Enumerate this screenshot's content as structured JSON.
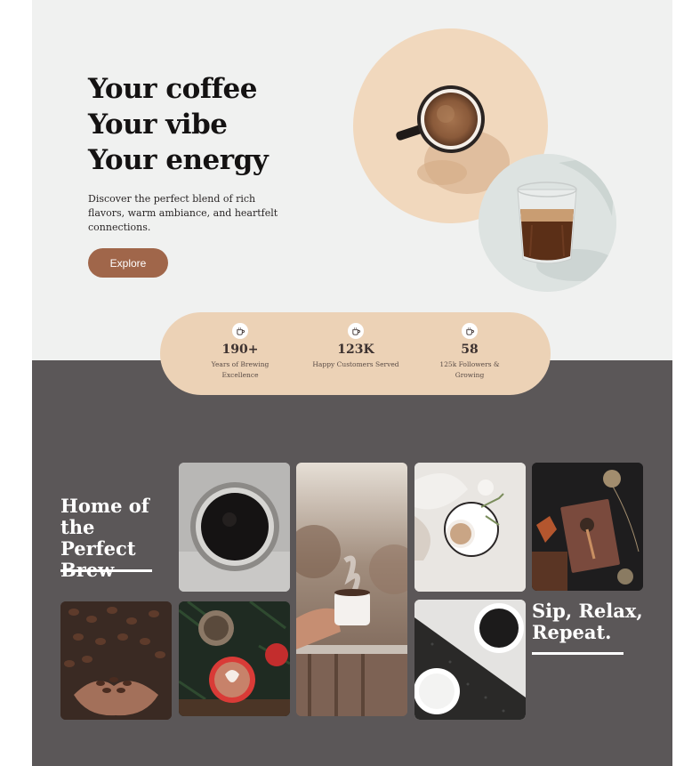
{
  "hero": {
    "title_lines": [
      "Your coffee",
      "Your vibe",
      "Your energy"
    ],
    "description": "Discover the perfect blend of rich flavors, warm ambiance, and heartfelt connections.",
    "explore_label": "Explore"
  },
  "stats": [
    {
      "icon": "coffee-cup-icon",
      "value": "190+",
      "label": "Years of Brewing Excellence"
    },
    {
      "icon": "coffee-cup-icon",
      "value": "123K",
      "label": "Happy Customers Served"
    },
    {
      "icon": "coffee-cup-icon",
      "value": "58",
      "label": "125k Followers & Growing"
    }
  ],
  "gallery": {
    "heading_left": "Home of the Perfect Brew",
    "heading_right": "Sip, Relax, Repeat."
  },
  "colors": {
    "accent": "#a0664a",
    "stats_bg": "#ecd2b6",
    "gallery_bg": "#5b5758",
    "hero_bg": "#f0f1f0"
  }
}
